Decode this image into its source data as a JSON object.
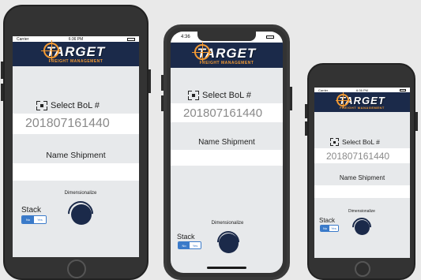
{
  "phones": [
    {
      "status_left": "Carrier",
      "status_time": "6:36 PM",
      "logo_word": "TARGET",
      "logo_sub": "FREIGHT MANAGEMENT",
      "select_label": "Select BoL #",
      "bol_value": "201807161440",
      "ship_label": "Name Shipment",
      "stack_label": "Stack",
      "seg_no": "No",
      "seg_yes": "Yes",
      "dim_label": "Dimensionalize"
    },
    {
      "status_time": "4:36",
      "logo_word": "TARGET",
      "logo_sub": "FREIGHT MANAGEMENT",
      "select_label": "Select BoL #",
      "bol_value": "201807161440",
      "ship_label": "Name Shipment",
      "stack_label": "Stack",
      "seg_no": "No",
      "seg_yes": "Yes",
      "dim_label": "Dimensionalize"
    },
    {
      "status_left": "Carrier",
      "status_time": "6:36 PM",
      "logo_word": "TARGET",
      "logo_sub": "FREIGHT MANAGEMENT",
      "select_label": "Select BoL #",
      "bol_value": "201807161440",
      "ship_label": "Name Shipment",
      "stack_label": "Stack",
      "seg_no": "No",
      "seg_yes": "Yes",
      "dim_label": "Dimensionalize"
    }
  ],
  "colors": {
    "banner": "#1b2a4a",
    "accent_orange": "#f39a33",
    "segment_blue": "#3a7ac9",
    "screen_bg": "#e7e9eb"
  }
}
